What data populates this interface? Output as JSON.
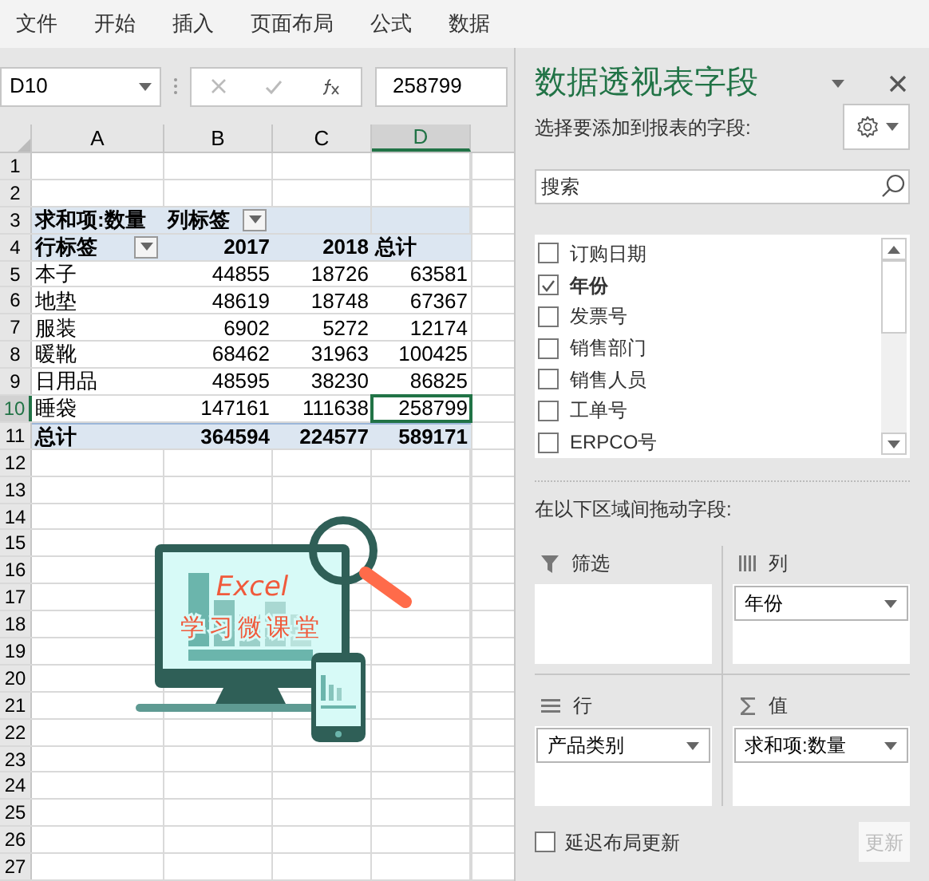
{
  "ribbon_tabs": [
    {
      "label": "文件"
    },
    {
      "label": "开始"
    },
    {
      "label": "插入"
    },
    {
      "label": "页面布局"
    },
    {
      "label": "公式"
    },
    {
      "label": "数据"
    }
  ],
  "name_box": {
    "value": "D10"
  },
  "formula_bar": {
    "value": "258799"
  },
  "columns": [
    {
      "label": "A",
      "selected": false
    },
    {
      "label": "B",
      "selected": false
    },
    {
      "label": "C",
      "selected": false
    },
    {
      "label": "D",
      "selected": true
    }
  ],
  "rows": [
    {
      "number": "1",
      "kind": "blank",
      "selected": false
    },
    {
      "number": "2",
      "kind": "blank",
      "selected": false
    },
    {
      "number": "3",
      "kind": "header",
      "selected": false,
      "cells": [
        {
          "text": "求和项:数量",
          "kind": "label",
          "dropdown": false
        },
        {
          "text": "列标签",
          "kind": "label",
          "dropdown": true
        }
      ]
    },
    {
      "number": "4",
      "kind": "header",
      "selected": false,
      "cells": [
        {
          "text": "行标签",
          "kind": "label",
          "dropdown": true
        },
        {
          "text": "2017",
          "kind": "number",
          "dropdown": false
        },
        {
          "text": "2018",
          "kind": "number",
          "dropdown": false
        },
        {
          "text": "总计",
          "kind": "label",
          "dropdown": false
        }
      ]
    },
    {
      "number": "5",
      "kind": "data",
      "selected": false,
      "cells": [
        {
          "text": "本子",
          "kind": "label",
          "selected": false
        },
        {
          "text": "44855",
          "kind": "number",
          "selected": false
        },
        {
          "text": "18726",
          "kind": "number",
          "selected": false
        },
        {
          "text": "63581",
          "kind": "number",
          "selected": false
        }
      ]
    },
    {
      "number": "6",
      "kind": "data",
      "selected": false,
      "cells": [
        {
          "text": "地垫",
          "kind": "label",
          "selected": false
        },
        {
          "text": "48619",
          "kind": "number",
          "selected": false
        },
        {
          "text": "18748",
          "kind": "number",
          "selected": false
        },
        {
          "text": "67367",
          "kind": "number",
          "selected": false
        }
      ]
    },
    {
      "number": "7",
      "kind": "data",
      "selected": false,
      "cells": [
        {
          "text": "服装",
          "kind": "label",
          "selected": false
        },
        {
          "text": "6902",
          "kind": "number",
          "selected": false
        },
        {
          "text": "5272",
          "kind": "number",
          "selected": false
        },
        {
          "text": "12174",
          "kind": "number",
          "selected": false
        }
      ]
    },
    {
      "number": "8",
      "kind": "data",
      "selected": false,
      "cells": [
        {
          "text": "暖靴",
          "kind": "label",
          "selected": false
        },
        {
          "text": "68462",
          "kind": "number",
          "selected": false
        },
        {
          "text": "31963",
          "kind": "number",
          "selected": false
        },
        {
          "text": "100425",
          "kind": "number",
          "selected": false
        }
      ]
    },
    {
      "number": "9",
      "kind": "data",
      "selected": false,
      "cells": [
        {
          "text": "日用品",
          "kind": "label",
          "selected": false
        },
        {
          "text": "48595",
          "kind": "number",
          "selected": false
        },
        {
          "text": "38230",
          "kind": "number",
          "selected": false
        },
        {
          "text": "86825",
          "kind": "number",
          "selected": false
        }
      ]
    },
    {
      "number": "10",
      "kind": "data",
      "selected": true,
      "cells": [
        {
          "text": "睡袋",
          "kind": "label",
          "selected": false
        },
        {
          "text": "147161",
          "kind": "number",
          "selected": false
        },
        {
          "text": "111638",
          "kind": "number",
          "selected": false
        },
        {
          "text": "258799",
          "kind": "number",
          "selected": true
        }
      ]
    },
    {
      "number": "11",
      "kind": "total",
      "selected": false,
      "cells": [
        {
          "text": "总计",
          "kind": "label"
        },
        {
          "text": "364594",
          "kind": "number"
        },
        {
          "text": "224577",
          "kind": "number"
        },
        {
          "text": "589171",
          "kind": "number"
        }
      ]
    },
    {
      "number": "12",
      "kind": "blank",
      "selected": false
    },
    {
      "number": "13",
      "kind": "blank",
      "selected": false
    },
    {
      "number": "14",
      "kind": "blank",
      "selected": false
    },
    {
      "number": "15",
      "kind": "blank",
      "selected": false
    },
    {
      "number": "16",
      "kind": "blank",
      "selected": false
    },
    {
      "number": "17",
      "kind": "blank",
      "selected": false
    },
    {
      "number": "18",
      "kind": "blank",
      "selected": false
    },
    {
      "number": "19",
      "kind": "blank",
      "selected": false
    },
    {
      "number": "20",
      "kind": "blank",
      "selected": false
    },
    {
      "number": "21",
      "kind": "blank",
      "selected": false
    },
    {
      "number": "22",
      "kind": "blank",
      "selected": false
    },
    {
      "number": "23",
      "kind": "blank",
      "selected": false
    },
    {
      "number": "24",
      "kind": "blank",
      "selected": false
    },
    {
      "number": "25",
      "kind": "blank",
      "selected": false
    },
    {
      "number": "26",
      "kind": "blank",
      "selected": false
    },
    {
      "number": "27",
      "kind": "blank",
      "selected": false
    }
  ],
  "logo": {
    "title": "Excel",
    "subtitle": "学习微课堂"
  },
  "pivot_pane": {
    "title": "数据透视表字段",
    "prompt": "选择要添加到报表的字段:",
    "search": {
      "placeholder": "搜索"
    },
    "fields": [
      {
        "label": "订购日期",
        "checked": false
      },
      {
        "label": "年份",
        "checked": true
      },
      {
        "label": "发票号",
        "checked": false
      },
      {
        "label": "销售部门",
        "checked": false
      },
      {
        "label": "销售人员",
        "checked": false
      },
      {
        "label": "工单号",
        "checked": false
      },
      {
        "label": "ERPCO号",
        "checked": false
      }
    ],
    "areas_prompt": "在以下区域间拖动字段:",
    "areas": [
      {
        "kind": "filter",
        "label": "筛选"
      },
      {
        "kind": "columns",
        "label": "列",
        "items": [
          "年份"
        ]
      },
      {
        "kind": "rows",
        "label": "行",
        "items": [
          "产品类别"
        ]
      },
      {
        "kind": "values",
        "label": "值",
        "items": [
          "求和项:数量"
        ]
      }
    ],
    "defer_update": {
      "label": "延迟布局更新",
      "checked": false
    },
    "update_button": {
      "label": "更新",
      "disabled": true
    }
  }
}
